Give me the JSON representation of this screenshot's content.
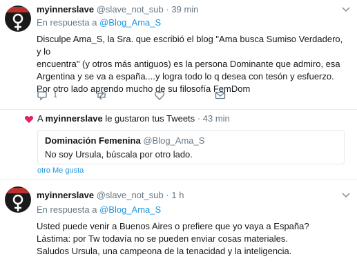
{
  "colors": {
    "link": "#1b95e0",
    "muted": "#657786",
    "heart": "#e0245e",
    "text": "#14171a",
    "divider": "#e6ecf0"
  },
  "tweets": [
    {
      "name": "myinnerslave",
      "handle": "@slave_not_sub",
      "separator": "·",
      "time": "39 min",
      "reply_prefix": "En respuesta a",
      "reply_handle": "@Blog_Ama_S",
      "lines": [
        "Disculpe Ama_S, la Sra. que escribió el blog \"Ama busca Sumiso Verdadero, y lo",
        "encuentra\" (y otros más antiguos) es la persona Dominante que admiro, esa",
        "Argentina y se va a españa....y logra todo lo q desea con tesón y esfuerzo.",
        "Por otro lado aprendo mucho de su filosofía FemDom"
      ],
      "reply_count": "1",
      "avatar_icon": "venus-symbol-icon"
    },
    {
      "name": "myinnerslave",
      "handle": "@slave_not_sub",
      "separator": "·",
      "time": "1 h",
      "reply_prefix": "En respuesta a",
      "reply_handle": "@Blog_Ama_S",
      "lines": [
        "Usted puede venir a Buenos Aires o prefiere que yo vaya a España?",
        "Lástima: por Tw todavía no se pueden enviar cosas materiales.",
        "Saludos Ursula, una campeona de la tenacidad y la inteligencia."
      ],
      "avatar_icon": "venus-symbol-icon"
    }
  ],
  "notification": {
    "prefix": "A",
    "who": "myinnerslave",
    "text": "le gustaron tus Tweets",
    "separator": "·",
    "time": "43 min",
    "quote_name": "Dominación Femenina",
    "quote_handle": "@Blog_Ama_S",
    "quote_text": "No soy Ursula, búscala por otro lado.",
    "more_link": "otro Me gusta",
    "icon": "heart-icon"
  }
}
